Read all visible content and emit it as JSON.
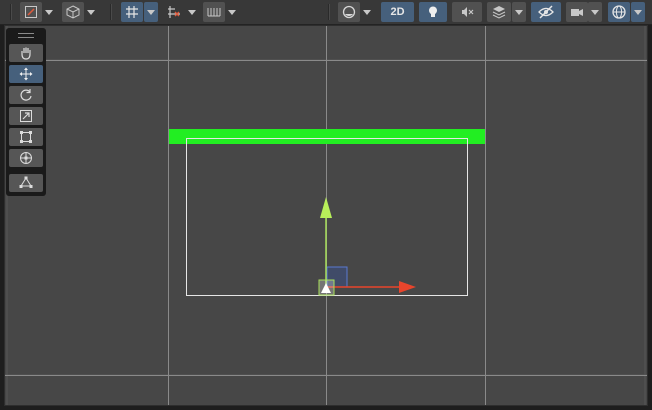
{
  "toolbar": {
    "left": [
      {
        "name": "draw-mode-button",
        "icon": "draw-mode-icon"
      },
      {
        "name": "view-options-button",
        "icon": "cube-icon"
      },
      {
        "name": "grid-snap-button",
        "icon": "grid-snap-icon",
        "active": true
      },
      {
        "name": "increment-snap-button",
        "icon": "increment-snap-icon"
      },
      {
        "name": "grid-visibility-button",
        "icon": "grid-ruler-icon"
      }
    ],
    "right": [
      {
        "name": "shading-mode-button",
        "icon": "shading-sphere-icon"
      },
      {
        "name": "2d-toggle-button",
        "label": "2D",
        "active": true
      },
      {
        "name": "lighting-toggle-button",
        "icon": "lightbulb-icon",
        "active": true
      },
      {
        "name": "audio-toggle-button",
        "icon": "audio-muted-icon"
      },
      {
        "name": "effects-button",
        "icon": "effects-icon"
      },
      {
        "name": "hidden-objects-button",
        "icon": "eye-hidden-icon",
        "active": true
      },
      {
        "name": "camera-button",
        "icon": "camera-icon"
      },
      {
        "name": "gizmos-button",
        "icon": "gizmos-icon",
        "active": true
      }
    ]
  },
  "tools": [
    {
      "name": "hand-tool",
      "icon": "hand-icon"
    },
    {
      "name": "move-tool",
      "icon": "move-arrows-icon",
      "active": true
    },
    {
      "name": "rotate-tool",
      "icon": "rotate-icon"
    },
    {
      "name": "scale-tool",
      "icon": "scale-icon"
    },
    {
      "name": "rect-tool",
      "icon": "rect-transform-icon"
    },
    {
      "name": "transform-tool",
      "icon": "transform-icon"
    },
    {
      "name": "custom-tool",
      "icon": "custom-editor-tool-icon"
    }
  ],
  "colors": {
    "viewport_bg": "#474747",
    "grid_line": "#5a5a5a",
    "major_grid_line": "#8c8c8c",
    "green_object": "#22ee22",
    "selection_outline": "#e6e6e6",
    "x_axis": "#e8452c",
    "y_axis": "#a8e05a",
    "z_plane": "#4a6bb8",
    "active_button": "#46607c"
  }
}
